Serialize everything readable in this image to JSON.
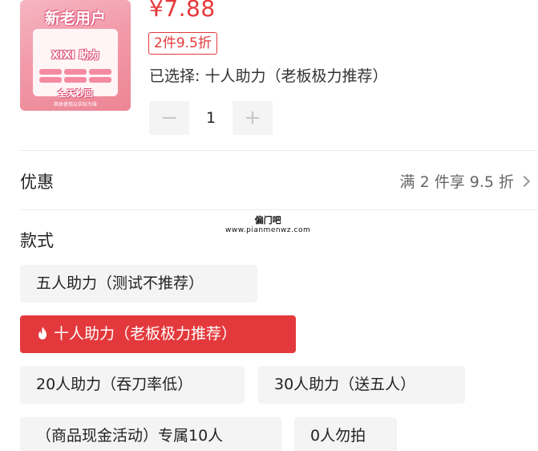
{
  "product": {
    "thumbnail": {
      "headline": "新老用户",
      "brand": "XIXI 助力",
      "tagline": "全天秒回",
      "footer": "具体使用以实际为准"
    },
    "price": "¥7.88",
    "discount_tag": "2件9.5折",
    "selected_text": "已选择: 十人助力（老板极力推荐）"
  },
  "quantity": {
    "minus": "−",
    "value": "1",
    "plus": "+"
  },
  "coupon": {
    "label": "优惠",
    "info": "满 2 件享 9.5 折"
  },
  "watermark": {
    "line1": "偏门吧",
    "line2": "www.pianmenwz.com"
  },
  "style": {
    "label": "款式",
    "options": [
      {
        "label": "五人助力（测试不推荐）",
        "selected": false
      },
      {
        "label": "十人助力（老板极力推荐）",
        "selected": true
      },
      {
        "label": "20人助力（吞刀率低）",
        "selected": false
      },
      {
        "label": "30人助力（送五人）",
        "selected": false
      },
      {
        "label": "（商品现金活动）专属10人",
        "selected": false
      },
      {
        "label": "0人勿拍",
        "selected": false
      }
    ]
  },
  "colors": {
    "accent": "#e4393c",
    "option_bg": "#f4f4f4"
  }
}
